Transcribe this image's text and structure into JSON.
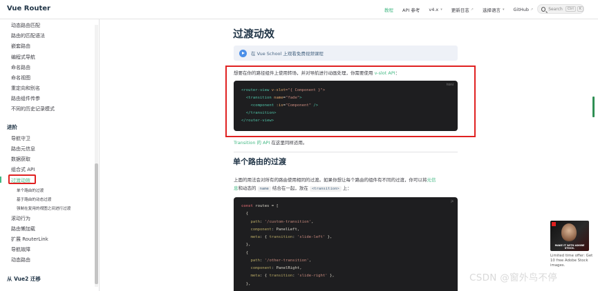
{
  "nav": {
    "brand": "Vue Router",
    "links": [
      {
        "label": "教程",
        "active": true
      },
      {
        "label": "API 参考",
        "active": false
      },
      {
        "label": "v4.x",
        "caret": true
      },
      {
        "label": "更新日志",
        "external": true
      },
      {
        "label": "选择语言",
        "caret": true
      },
      {
        "label": "GitHub",
        "external": true
      }
    ],
    "search": {
      "placeholder": "Search",
      "keys": [
        "Ctrl",
        "K"
      ]
    }
  },
  "sidebar": {
    "items_top": [
      "动态路由匹配",
      "路由的匹配语法",
      "嵌套路由",
      "编程式导航",
      "命名路由",
      "命名视图",
      "重定向和别名",
      "路由组件传参",
      "不同的历史记录模式"
    ],
    "section": "进阶",
    "items_adv": [
      "导航守卫",
      "路由元信息",
      "数据获取",
      "组合式 API",
      "过渡动效"
    ],
    "subitems": [
      "单个路由的过渡",
      "基于路由的动态过渡",
      "强制在复用的视图之间进行过渡"
    ],
    "items_more": [
      "滚动行为",
      "路由懒加载",
      "扩展 RouterLink",
      "导航故障",
      "动态路由"
    ],
    "footer_section": "从 Vue2 迁移",
    "accent": "#42b883"
  },
  "main": {
    "title": "过渡动效",
    "vueschool": "在 Vue School 上观看免费视频课程",
    "intro_text": "想要在你的路径组件上使用转场，并对导航进行动画处理，你需要使用 ",
    "intro_link": "v-slot API",
    "intro_end": "：",
    "code1_lang": "html",
    "code1": {
      "l1a": "<router-view ",
      "l1b": "v-slot",
      "l1c": "=\"{ Component }\">",
      "l2a": "  <transition ",
      "l2b": "name",
      "l2c": "=",
      "l2d": "\"fade\"",
      "l2e": ">",
      "l3a": "    <component ",
      "l3b": ":is",
      "l3c": "=",
      "l3d": "\"Component\"",
      "l3e": " />",
      "l4": "  </transition>",
      "l5": "</router-view>"
    },
    "transition_link": "Transition 的 API",
    "transition_rest": " 在这里同样适用。",
    "h2": "单个路由的过渡",
    "para2_a": "上面的用法会对所有的路由使用相同的过渡。如果你想让每个路由的组件有不同的过渡，你可以将",
    "para2_link": "元信",
    "para2_b_link": "息",
    "para2_b": "和动态的 ",
    "para2_code1": "name",
    "para2_c": " 结合在一起，放在 ",
    "para2_code2": "<transition>",
    "para2_d": " 上：",
    "code2_lang": "js",
    "code2": {
      "l1a": "const ",
      "l1b": "routes",
      "l1c": " = [",
      "l2": "  {",
      "l3a": "    path",
      "l3b": ": ",
      "l3c": "'/custom-transition'",
      "l3d": ",",
      "l4a": "    component",
      "l4b": ": ",
      "l4c": "PanelLeft",
      "l4d": ",",
      "l5a": "    meta",
      "l5b": ": { ",
      "l5c": "transition",
      "l5d": ": ",
      "l5e": "'slide-left'",
      "l5f": " },",
      "l6": "  },",
      "l7": "  {",
      "l8a": "    path",
      "l8b": ": ",
      "l8c": "'/other-transition'",
      "l8d": ",",
      "l9a": "    component",
      "l9b": ": ",
      "l9c": "PanelRight",
      "l9d": ",",
      "l10a": "    meta",
      "l10b": ": { ",
      "l10c": "transition",
      "l10d": ": ",
      "l10e": "'slide-right'",
      "l10f": " },",
      "l11": "  },"
    }
  },
  "ad": {
    "caption": "MAKE IT WITH ADOBE STOCK.",
    "text": "Limited time offer: Get 10 free Adobe Stock images."
  },
  "watermark": "CSDN @窗外鸟不停"
}
